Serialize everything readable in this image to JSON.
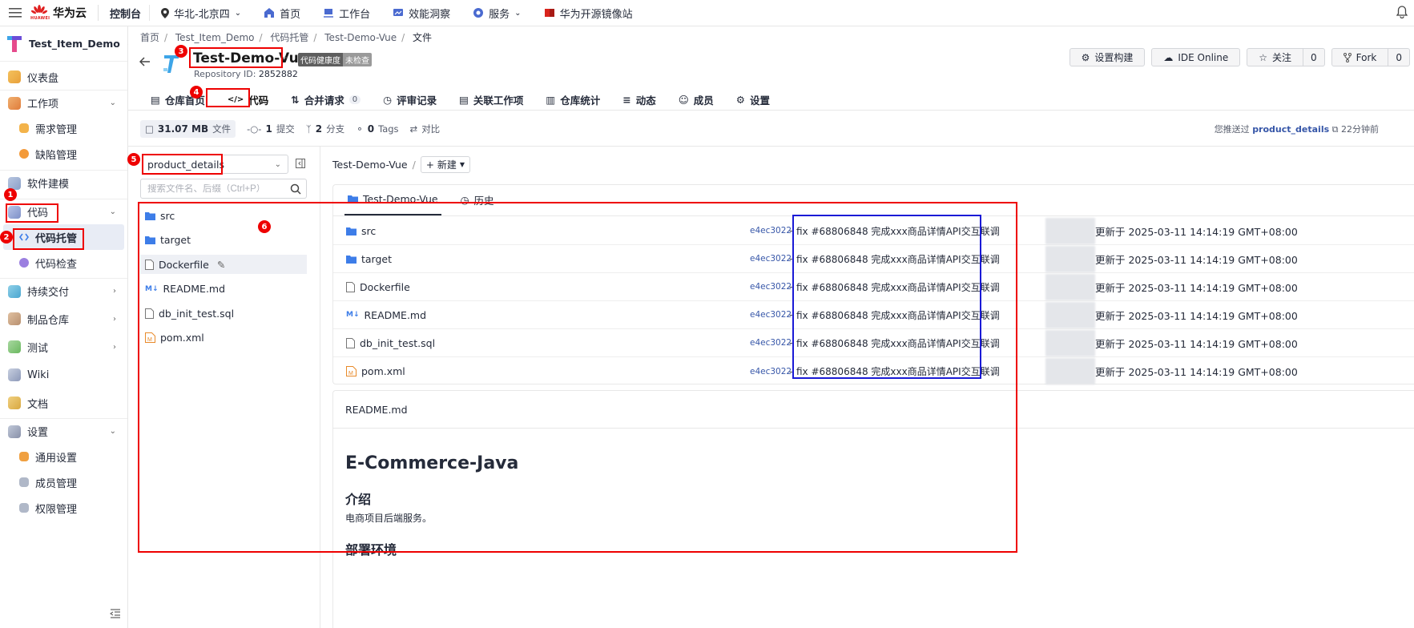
{
  "topbar": {
    "logo_text": "HUAWEI",
    "brand": "华为云",
    "console": "控制台",
    "region": "华北-北京四",
    "items": [
      "首页",
      "工作台",
      "效能洞察",
      "服务",
      "华为开源镜像站"
    ]
  },
  "sidebar": {
    "project": "Test_Item_Demo",
    "items": [
      {
        "label": "仪表盘"
      },
      {
        "label": "工作项"
      },
      {
        "label": "需求管理"
      },
      {
        "label": "缺陷管理"
      },
      {
        "label": "软件建模"
      },
      {
        "label": "代码"
      },
      {
        "label": "代码托管"
      },
      {
        "label": "代码检查"
      },
      {
        "label": "持续交付"
      },
      {
        "label": "制品仓库"
      },
      {
        "label": "测试"
      },
      {
        "label": "Wiki"
      },
      {
        "label": "文档"
      },
      {
        "label": "设置"
      },
      {
        "label": "通用设置"
      },
      {
        "label": "成员管理"
      },
      {
        "label": "权限管理"
      }
    ]
  },
  "breadcrumb": [
    "首页",
    "Test_Item_Demo",
    "代码托管",
    "Test-Demo-Vue",
    "文件"
  ],
  "repo": {
    "name": "Test-Demo-Vue",
    "health_label": "代码健康度",
    "health_value": "未检查",
    "id_label": "Repository ID:",
    "id": "2852882"
  },
  "actions": {
    "build": "设置构建",
    "ide": "IDE Online",
    "watch": "关注",
    "watch_count": "0",
    "fork": "Fork",
    "fork_count": "0"
  },
  "tabs": [
    {
      "label": "仓库首页"
    },
    {
      "label": "代码"
    },
    {
      "label": "合并请求",
      "count": "0"
    },
    {
      "label": "评审记录"
    },
    {
      "label": "关联工作项"
    },
    {
      "label": "仓库统计"
    },
    {
      "label": "动态"
    },
    {
      "label": "成员"
    },
    {
      "label": "设置"
    }
  ],
  "stats": {
    "size": "31.07 MB",
    "size_label": "文件",
    "commits": "1",
    "commits_label": "提交",
    "branches": "2",
    "branches_label": "分支",
    "tags": "0",
    "tags_label": "Tags",
    "compare": "对比",
    "pushed_prefix": "您推送过",
    "pushed_branch": "product_details",
    "pushed_time": "22分钟前"
  },
  "left_panel": {
    "branch": "product_details",
    "search_placeholder": "搜索文件名、后缀（Ctrl+P）",
    "tree": [
      "src",
      "target",
      "Dockerfile",
      "README.md",
      "db_init_test.sql",
      "pom.xml"
    ]
  },
  "right_panel": {
    "path": "Test-Demo-Vue",
    "new_label": "新建",
    "card_tabs": [
      "Test-Demo-Vue",
      "历史"
    ],
    "files": [
      {
        "name": "src",
        "hash": "e4ec3022",
        "msg": "fix #68806848 完成xxx商品详情API交互联调",
        "updated": "更新于 2025-03-11 14:14:19 GMT+08:00"
      },
      {
        "name": "target",
        "hash": "e4ec3022",
        "msg": "fix #68806848 完成xxx商品详情API交互联调",
        "updated": "更新于 2025-03-11 14:14:19 GMT+08:00"
      },
      {
        "name": "Dockerfile",
        "hash": "e4ec3022",
        "msg": "fix #68806848 完成xxx商品详情API交互联调",
        "updated": "更新于 2025-03-11 14:14:19 GMT+08:00"
      },
      {
        "name": "README.md",
        "hash": "e4ec3022",
        "msg": "fix #68806848 完成xxx商品详情API交互联调",
        "updated": "更新于 2025-03-11 14:14:19 GMT+08:00"
      },
      {
        "name": "db_init_test.sql",
        "hash": "e4ec3022",
        "msg": "fix #68806848 完成xxx商品详情API交互联调",
        "updated": "更新于 2025-03-11 14:14:19 GMT+08:00"
      },
      {
        "name": "pom.xml",
        "hash": "e4ec3022",
        "msg": "fix #68806848 完成xxx商品详情API交互联调",
        "updated": "更新于 2025-03-11 14:14:19 GMT+08:00"
      }
    ]
  },
  "readme": {
    "filename": "README.md",
    "h1": "E-Commerce-Java",
    "h2_intro": "介绍",
    "intro_text": "电商项目后端服务。",
    "h2_deploy": "部署环境"
  },
  "annotations": [
    "1",
    "2",
    "3",
    "4",
    "5",
    "6"
  ],
  "colors": {
    "annotation_red": "#e00000",
    "annotation_blue": "#1a1ad6",
    "link_blue": "#3656a8",
    "folder_blue": "#3d7de8"
  }
}
